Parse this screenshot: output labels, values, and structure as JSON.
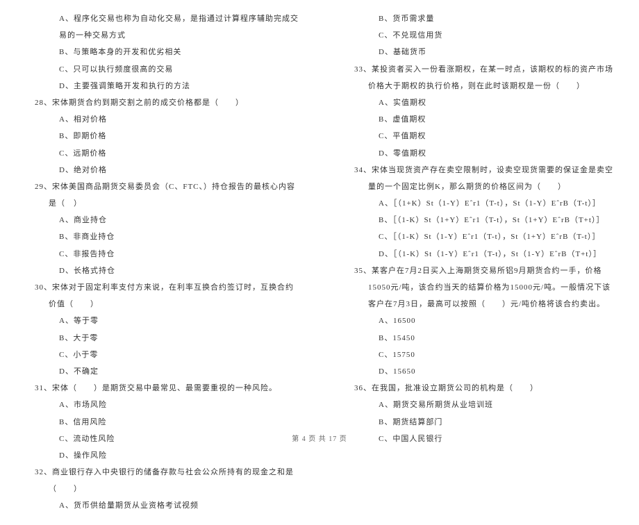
{
  "left_column": {
    "pre_options": [
      "A、程序化交易也称为自动化交易，是指通过计算程序辅助完成交易的一种交易方式",
      "B、与策略本身的开发和优劣相关",
      "C、只可以执行频度很高的交易",
      "D、主要强调策略开发和执行的方法"
    ],
    "q28": {
      "text": "28、宋体期货合约到期交割之前的成交价格都是（　　）",
      "options": [
        "A、相对价格",
        "B、即期价格",
        "C、远期价格",
        "D、绝对价格"
      ]
    },
    "q29": {
      "text": "29、宋体美国商品期货交易委员会（C、FTC、）持仓报告的最核心内容是（　）",
      "options": [
        "A、商业持仓",
        "B、非商业持仓",
        "C、非报告持仓",
        "D、长格式持仓"
      ]
    },
    "q30": {
      "text": "30、宋体对于固定利率支付方来说，在利率互换合约签订时，互换合约价值（　　）",
      "options": [
        "A、等于零",
        "B、大于零",
        "C、小于零",
        "D、不确定"
      ]
    },
    "q31": {
      "text": "31、宋体（　　）是期货交易中最常见、最需要重视的一种风险。",
      "options": [
        "A、市场风险",
        "B、信用风险",
        "C、流动性风险",
        "D、操作风险"
      ]
    },
    "q32": {
      "text": "32、商业银行存入中央银行的储备存款与社会公众所持有的现金之和是（　　）",
      "options": [
        "A、货币供给量期货从业资格考试视频"
      ]
    }
  },
  "right_column": {
    "pre_options": [
      "B、货币需求量",
      "C、不兑现信用货",
      "D、基础货币"
    ],
    "q33": {
      "text": "33、某投资者买入一份看涨期权，在某一时点，该期权的标的资产市场价格大于期权的执行价格，则在此时该期权是一份（　　）",
      "options": [
        "A、实值期权",
        "B、虚值期权",
        "C、平值期权",
        "D、零值期权"
      ]
    },
    "q34": {
      "text": "34、宋体当现货资产存在卖空限制时，设卖空现货需要的保证金是卖空量的一个固定比例K，那么期货的价格区间为（　　）",
      "options": [
        "A、［（1+K）St（1-Y）Eˆr1（T-t），St（1-Y）EˆrB（T-t）］",
        "B、［（1-K）St（1+Y）Eˆr1（T-t），St（1+Y）EˆrB（T+t）］",
        "C、［（1-K）St（1-Y）Eˆr1（T-t），St（1+Y）EˆrB（T-t）］",
        "D、［（1-K）St（1-Y）Eˆr1（T-t），St（1-Y）EˆrB（T+t）］"
      ]
    },
    "q35": {
      "text": "35、某客户在7月2日买入上海期货交易所铝9月期货合约一手，价格15050元/吨，该合约当天的结算价格为15000元/吨。一般情况下该客户在7月3日，最高可以按照（　　）元/吨价格将该合约卖出。",
      "options": [
        "A、16500",
        "B、15450",
        "C、15750",
        "D、15650"
      ]
    },
    "q36": {
      "text": "36、在我国，批准设立期货公司的机构是（　　）",
      "options": [
        "A、期货交易所期货从业培训班",
        "B、期货结算部门",
        "C、中国人民银行"
      ]
    }
  },
  "footer": "第 4 页 共 17 页"
}
